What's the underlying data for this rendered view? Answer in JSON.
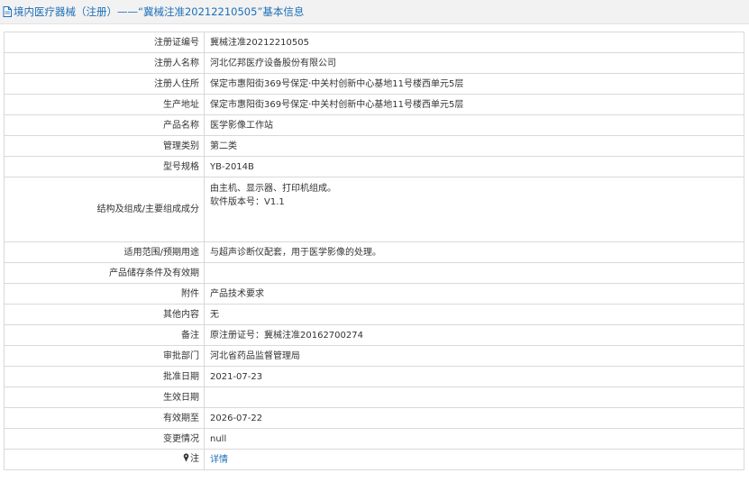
{
  "header": {
    "title": "境内医疗器械（注册）——“冀械注准20212210505”基本信息"
  },
  "rows": [
    {
      "label": "注册证编号",
      "value": "冀械注准20212210505"
    },
    {
      "label": "注册人名称",
      "value": "河北亿邦医疗设备股份有限公司"
    },
    {
      "label": "注册人住所",
      "value": "保定市惠阳街369号保定·中关村创新中心基地11号楼西单元5层"
    },
    {
      "label": "生产地址",
      "value": "保定市惠阳街369号保定·中关村创新中心基地11号楼西单元5层"
    },
    {
      "label": "产品名称",
      "value": "医学影像工作站"
    },
    {
      "label": "管理类别",
      "value": "第二类"
    },
    {
      "label": "型号规格",
      "value": "YB-2014B"
    },
    {
      "label": "结构及组成/主要组成成分",
      "value_lines": [
        "由主机、显示器、打印机组成。",
        "软件版本号：V1.1"
      ]
    },
    {
      "label": "适用范围/预期用途",
      "value": "与超声诊断仪配套，用于医学影像的处理。"
    },
    {
      "label": "产品储存条件及有效期",
      "value": ""
    },
    {
      "label": "附件",
      "value": "产品技术要求"
    },
    {
      "label": "其他内容",
      "value": "无"
    },
    {
      "label": "备注",
      "value": "原注册证号：冀械注准20162700274"
    },
    {
      "label": "审批部门",
      "value": "河北省药品监督管理局"
    },
    {
      "label": "批准日期",
      "value": "2021-07-23"
    },
    {
      "label": "生效日期",
      "value": ""
    },
    {
      "label": "有效期至",
      "value": "2026-07-22"
    },
    {
      "label": "变更情况",
      "value": "null"
    },
    {
      "label": "注",
      "value": "详情"
    }
  ],
  "colors": {
    "title_text": "#1d6fb8",
    "link": "#1d6fb8",
    "title_bg": "#f2f2f2",
    "border": "#d9d9d9"
  },
  "icons": {
    "title": "document-icon",
    "note": "pin-icon"
  }
}
